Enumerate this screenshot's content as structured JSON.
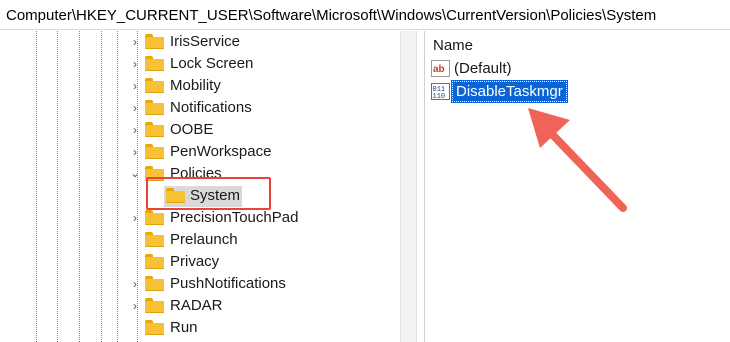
{
  "address_bar": {
    "path": "Computer\\HKEY_CURRENT_USER\\Software\\Microsoft\\Windows\\CurrentVersion\\Policies\\System"
  },
  "tree": {
    "items": [
      {
        "label": "IrisService",
        "expanded": false
      },
      {
        "label": "Lock Screen",
        "expanded": false
      },
      {
        "label": "Mobility",
        "expanded": false
      },
      {
        "label": "Notifications",
        "expanded": false
      },
      {
        "label": "OOBE",
        "expanded": false
      },
      {
        "label": "PenWorkspace",
        "expanded": false
      },
      {
        "label": "Policies",
        "expanded": true
      },
      {
        "label": "System",
        "selected": true
      },
      {
        "label": "PrecisionTouchPad",
        "expanded": false
      },
      {
        "label": "Prelaunch",
        "expanded": false
      },
      {
        "label": "Privacy",
        "expanded": false
      },
      {
        "label": "PushNotifications",
        "expanded": false
      },
      {
        "label": "RADAR",
        "expanded": false
      },
      {
        "label": "Run",
        "expanded": false
      }
    ]
  },
  "values_pane": {
    "column_header": "Name",
    "values": [
      {
        "name": "(Default)",
        "icon": "string-value-icon",
        "selected": false
      },
      {
        "name": "DisableTaskmgr",
        "icon": "dword-value-icon",
        "selected": true
      }
    ]
  },
  "colors": {
    "highlight_box": "#e8443a",
    "arrow": "#f06359",
    "selection": "#0a64d8",
    "folder": "#f7c136"
  }
}
